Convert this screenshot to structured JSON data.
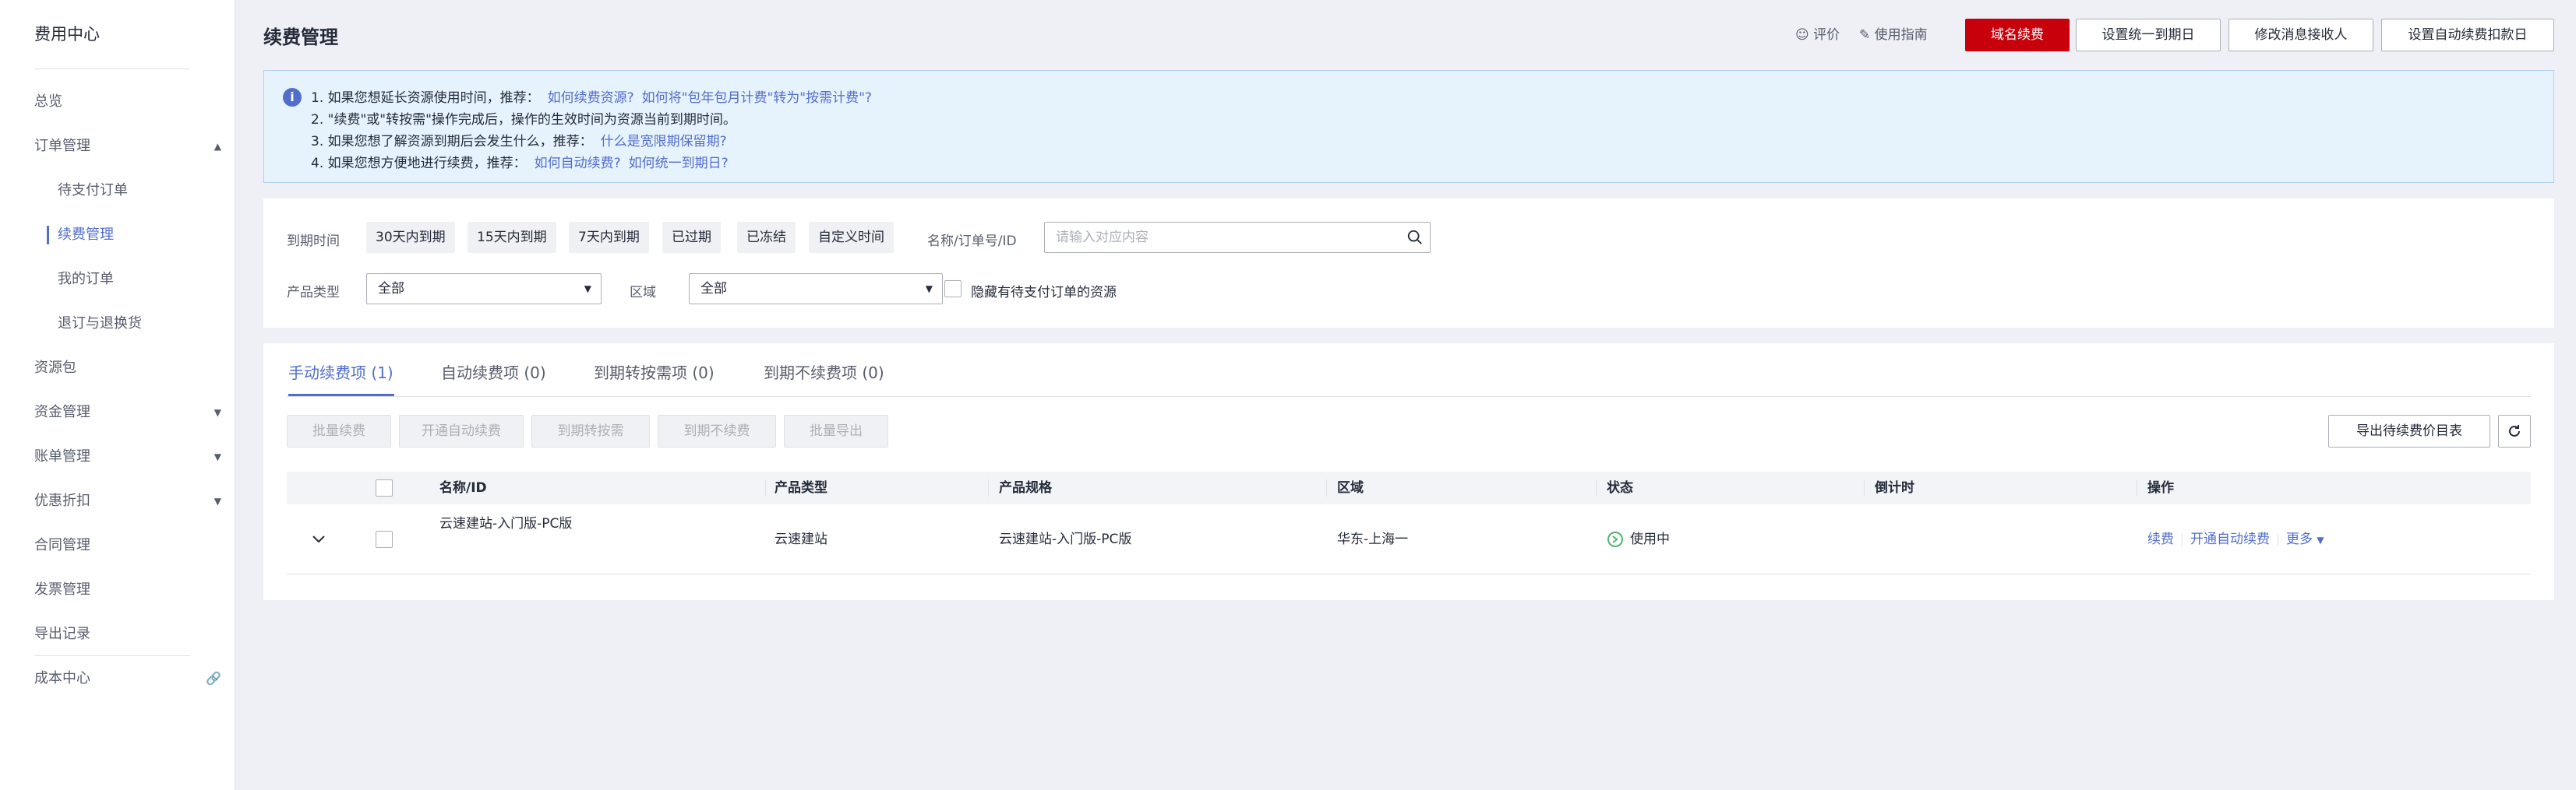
{
  "sidebar": {
    "title": "费用中心",
    "items": [
      {
        "label": "总览"
      },
      {
        "label": "订单管理"
      },
      {
        "label": "待支付订单"
      },
      {
        "label": "续费管理"
      },
      {
        "label": "我的订单"
      },
      {
        "label": "退订与退换货"
      },
      {
        "label": "资源包"
      },
      {
        "label": "资金管理"
      },
      {
        "label": "账单管理"
      },
      {
        "label": "优惠折扣"
      },
      {
        "label": "合同管理"
      },
      {
        "label": "发票管理"
      },
      {
        "label": "导出记录"
      },
      {
        "label": "成本中心"
      }
    ]
  },
  "header": {
    "title": "续费管理",
    "rate_label": "评价",
    "guide_label": "使用指南",
    "buttons": {
      "domain_renew": "域名续费",
      "set_unified_date": "设置统一到期日",
      "edit_receiver": "修改消息接收人",
      "set_auto_debit_date": "设置自动续费扣款日"
    }
  },
  "info": {
    "lines": [
      {
        "text": "1. 如果您想延长资源使用时间，推荐：",
        "links": [
          "如何续费资源?",
          "如何将\"包年包月计费\"转为\"按需计费\"?"
        ]
      },
      {
        "text": "2. \"续费\"或\"转按需\"操作完成后，操作的生效时间为资源当前到期时间。",
        "links": []
      },
      {
        "text": "3. 如果您想了解资源到期后会发生什么，推荐：",
        "links": [
          "什么是宽限期保留期?"
        ]
      },
      {
        "text": "4. 如果您想方便地进行续费，推荐：",
        "links": [
          "如何自动续费?",
          "如何统一到期日?"
        ]
      }
    ]
  },
  "filter": {
    "expire_label": "到期时间",
    "chips": [
      "30天内到期",
      "15天内到期",
      "7天内到期",
      "已过期",
      "已冻结",
      "自定义时间"
    ],
    "search_label": "名称/订单号/ID",
    "search_placeholder": "请输入对应内容",
    "product_type_label": "产品类型",
    "product_type_value": "全部",
    "region_label": "区域",
    "region_value": "全部",
    "hide_pending_label": "隐藏有待支付订单的资源"
  },
  "tabs": [
    "手动续费项 (1)",
    "自动续费项 (0)",
    "到期转按需项 (0)",
    "到期不续费项 (0)"
  ],
  "batch_buttons": [
    "批量续费",
    "开通自动续费",
    "到期转按需",
    "到期不续费",
    "批量导出"
  ],
  "export_label": "导出待续费价目表",
  "table": {
    "columns": [
      "名称/ID",
      "产品类型",
      "产品规格",
      "区域",
      "状态",
      "倒计时",
      "操作"
    ],
    "rows": [
      {
        "name": "云速建站-入门版-PC版",
        "product_type": "云速建站",
        "spec": "云速建站-入门版-PC版",
        "region": "华东-上海一",
        "status": "使用中",
        "countdown": "",
        "actions": [
          "续费",
          "开通自动续费",
          "更多"
        ]
      }
    ]
  }
}
